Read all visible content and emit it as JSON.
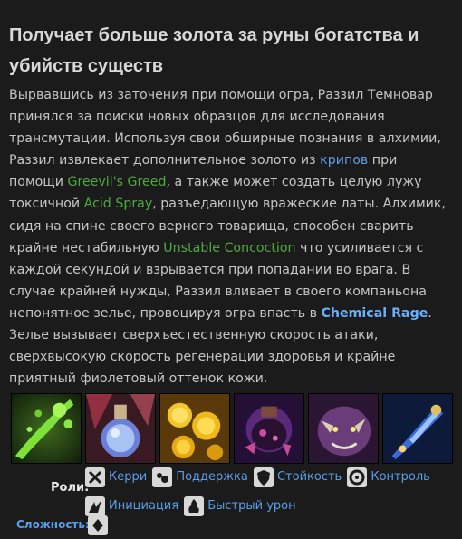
{
  "hero": {
    "title": "Получает больше золота за руны богатства и убийств существ",
    "bio": {
      "p1": "Вырвавшись из заточения при помощи огра, Раззил Темновар принялся за поиски новых образцов для исследования трансмутации. Используя свои обширные познания в алхимии, Раззил извлекает дополнительное золото из ",
      "link_creeps": "крипов",
      "p2": " при помощи ",
      "link_greed": "Greevil's Greed",
      "p3": ", а также может создать целую лужу токсичной ",
      "link_acid": "Acid Spray",
      "p4": ", разъедающую вражеские латы. Алхимик, сидя на спине своего верного товарища, способен сварить крайне нестабильную ",
      "link_concoction": "Unstable Concoction",
      "p5": " что усиливается с каждой секундой и взрывается при попадании во врага. В случае крайней нужды, Раззил вливает в своего компаньона непонятное зелье, провоцируя огра впасть в ",
      "link_rage": "Chemical Rage",
      "p6": ". Зелье вызывает сверхъестественную скорость атаки, сверхвысокую скорость регенерации здоровья и крайне приятный фиолетовый оттенок кожи."
    },
    "abilities": [
      {
        "icon": "acid-spray-icon"
      },
      {
        "icon": "unstable-concoction-icon"
      },
      {
        "icon": "greevils-greed-icon"
      },
      {
        "icon": "corrosive-weaponry-icon"
      },
      {
        "icon": "chemical-rage-icon"
      },
      {
        "icon": "berserk-potion-icon"
      }
    ],
    "roles_label": "Роли:",
    "roles": [
      {
        "label": "Керри",
        "icon": "carry-icon"
      },
      {
        "label": "Поддержка",
        "icon": "support-icon"
      },
      {
        "label": "Стойкость",
        "icon": "durable-icon"
      },
      {
        "label": "Контроль",
        "icon": "disabler-icon"
      },
      {
        "label": "Инициация",
        "icon": "initiator-icon"
      },
      {
        "label": "Быстрый урон",
        "icon": "nuker-icon"
      }
    ],
    "complexity_label": "Сложность:",
    "complexity_level": 1,
    "colors": {
      "background": "#1b1b1b",
      "link_green": "#4eaa3e",
      "link_blue": "#5a9ee8"
    }
  }
}
